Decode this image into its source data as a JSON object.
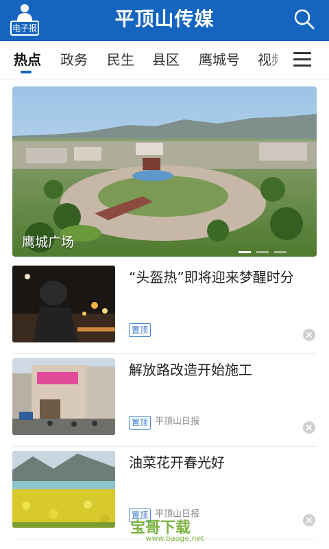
{
  "header": {
    "epaper_label": "电子报",
    "brand": "平顶山传媒"
  },
  "tabs": [
    {
      "label": "热点"
    },
    {
      "label": "政务"
    },
    {
      "label": "民生"
    },
    {
      "label": "县区"
    },
    {
      "label": "鹰城号"
    },
    {
      "label": "视频"
    }
  ],
  "hero": {
    "caption": "鹰城广场",
    "slide_count": 3,
    "active_slide": 1
  },
  "news": [
    {
      "title": "“头盔热”即将迎来梦醒时分",
      "tag": "置顶",
      "source": ""
    },
    {
      "title": "解放路改造开始施工",
      "tag": "置顶",
      "source": "平顶山日报"
    },
    {
      "title": "油菜花开春光好",
      "tag": "置顶",
      "source": "平顶山日报"
    }
  ],
  "watermark": {
    "logo_text": "宝哥下载",
    "url": "www.baoge.net"
  },
  "colors": {
    "primary": "#1565c0",
    "tag": "#2f74cc",
    "watermark": "#7cb342"
  }
}
